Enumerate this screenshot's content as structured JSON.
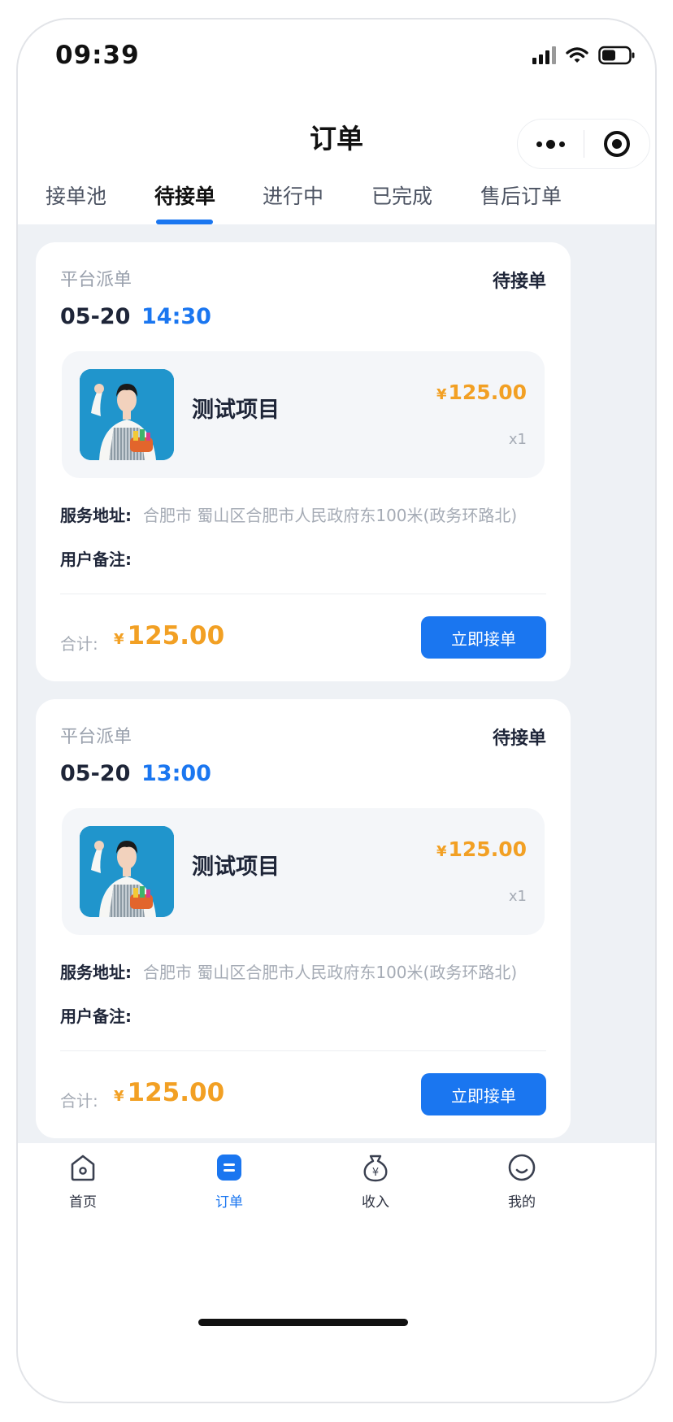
{
  "status_bar": {
    "time": "09:39"
  },
  "nav": {
    "title": "订单"
  },
  "tabs": [
    {
      "label": "接单池",
      "active": false
    },
    {
      "label": "待接单",
      "active": true
    },
    {
      "label": "进行中",
      "active": false
    },
    {
      "label": "已完成",
      "active": false
    },
    {
      "label": "售后订单",
      "active": false
    }
  ],
  "orders": [
    {
      "source": "平台派单",
      "status": "待接单",
      "date": "05-20",
      "time": "14:30",
      "item": {
        "name": "测试项目",
        "currency": "¥",
        "price": "125.00",
        "qty": "x1"
      },
      "address_label": "服务地址:",
      "address": "合肥市 蜀山区合肥市人民政府东100米(政务环路北)",
      "note_label": "用户备注:",
      "note": "",
      "total_label": "合计:",
      "total_currency": "¥",
      "total": "125.00",
      "action": "立即接单"
    },
    {
      "source": "平台派单",
      "status": "待接单",
      "date": "05-20",
      "time": "13:00",
      "item": {
        "name": "测试项目",
        "currency": "¥",
        "price": "125.00",
        "qty": "x1"
      },
      "address_label": "服务地址:",
      "address": "合肥市 蜀山区合肥市人民政府东100米(政务环路北)",
      "note_label": "用户备注:",
      "note": "",
      "total_label": "合计:",
      "total_currency": "¥",
      "total": "125.00",
      "action": "立即接单"
    }
  ],
  "tab_bar": [
    {
      "label": "首页",
      "icon": "home-icon",
      "active": false
    },
    {
      "label": "订单",
      "icon": "order-icon",
      "active": true
    },
    {
      "label": "收入",
      "icon": "income-icon",
      "active": false
    },
    {
      "label": "我的",
      "icon": "profile-icon",
      "active": false
    }
  ],
  "colors": {
    "accent": "#1a76f0",
    "price": "#f2a024",
    "background": "#eef1f5"
  }
}
